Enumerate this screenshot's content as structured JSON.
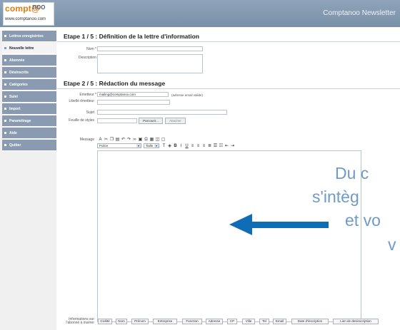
{
  "app": {
    "logo_brand": "compt@",
    "logo_brand_suffix": "noo",
    "logo_url": "www.comptanoo.com",
    "title": "Comptanoo Newsletter"
  },
  "sidebar": {
    "items": [
      {
        "label": "Lettres enregistrées",
        "active": false
      },
      {
        "label": "Nouvelle lettre",
        "active": true
      },
      {
        "label": "Abonnés",
        "active": false
      },
      {
        "label": "Désinscrits",
        "active": false
      },
      {
        "label": "Catégories",
        "active": false
      },
      {
        "label": "Suivi",
        "active": false
      },
      {
        "label": "Import",
        "active": false
      },
      {
        "label": "Paramétrage",
        "active": false
      },
      {
        "label": "Aide",
        "active": false
      },
      {
        "label": "Quitter",
        "active": false
      }
    ]
  },
  "step1": {
    "title": "Etape 1 / 5 : Définition de la lettre d'information",
    "name_label": "Nom *",
    "description_label": "Description"
  },
  "step2": {
    "title": "Etape 2 / 5 : Rédaction du message",
    "sender_label": "Emetteur *",
    "sender_value": "mailing@comptanoo.com",
    "sender_hint": "(adresse email valide)",
    "sender_name_label": "Libellé émetteur",
    "subject_label": "Sujet",
    "stylesheet_label": "Feuille de styles",
    "browse_button": "Parcourir...",
    "attach_button": "Attacher",
    "message_label": "Message",
    "font_select": "Police",
    "size_select": "Taille",
    "fields_label": "Informations sur l'abonné à insérer",
    "fields": [
      "Civilité",
      "Nom",
      "Prénom",
      "Entreprise",
      "Fonction",
      "Adresse",
      "CP",
      "Ville",
      "Tel",
      "Email",
      "Date d'inscription",
      "Lien de desinscription"
    ]
  },
  "toolbar": {
    "row1_icons": [
      "bold-text-icon",
      "cut-icon",
      "copy-icon",
      "paste-icon",
      "undo-icon",
      "redo-icon",
      "link-icon",
      "image-icon",
      "special-char-icon",
      "table-icon",
      "source-icon",
      "preview-icon"
    ],
    "row2_icons": [
      "text-color-icon",
      "bg-color-icon",
      "bold-icon",
      "italic-icon",
      "underline-icon",
      "align-left-icon",
      "align-center-icon",
      "align-right-icon",
      "justify-icon",
      "ordered-list-icon",
      "bullet-list-icon",
      "outdent-icon",
      "indent-icon"
    ]
  },
  "promo": {
    "line1": "Du c",
    "line2": "s'intèg",
    "line3": "et vo",
    "line4": "v",
    "color": "#6f9bc6",
    "arrow_color": "#0f6db5"
  }
}
